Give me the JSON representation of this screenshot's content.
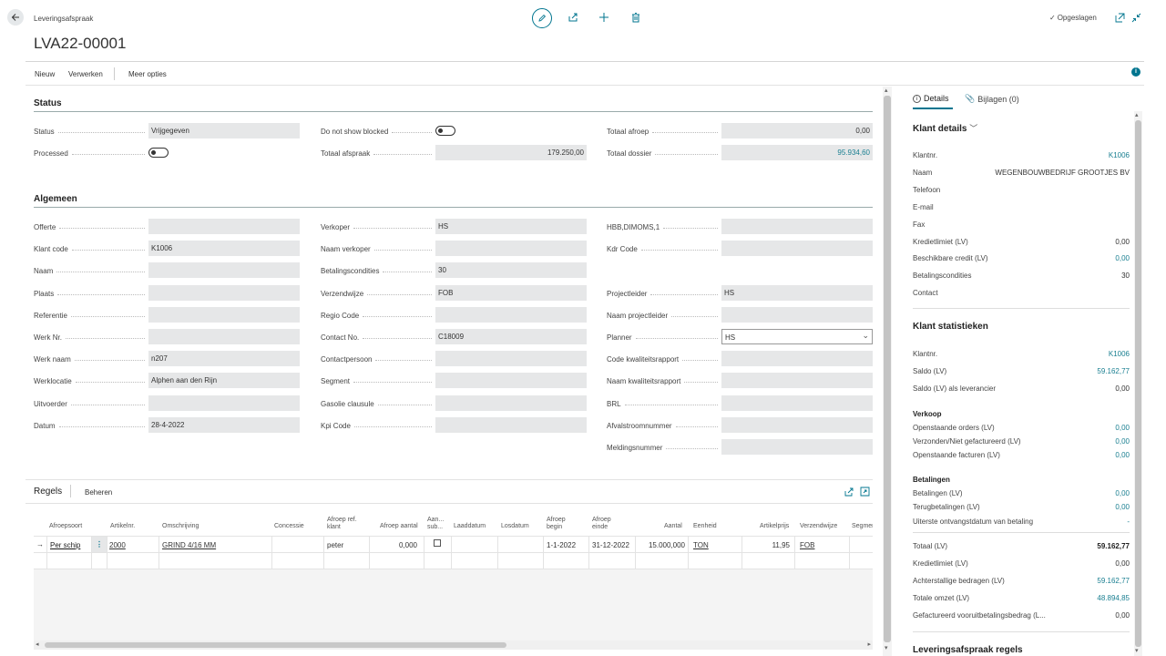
{
  "header": {
    "breadcrumb": "Leveringsafspraak",
    "title": "LVA22-00001",
    "saved_label": "Opgeslagen"
  },
  "actionbar": {
    "new_label": "Nieuw",
    "process_label": "Verwerken",
    "more_label": "Meer opties"
  },
  "status": {
    "heading": "Status",
    "status_label": "Status",
    "status_value": "Vrijgegeven",
    "processed_label": "Processed",
    "dnsb_label": "Do not show blocked",
    "totaal_afspraak_label": "Totaal afspraak",
    "totaal_afspraak_value": "179.250,00",
    "totaal_afroep_label": "Totaal afroep",
    "totaal_afroep_value": "0,00",
    "totaal_dossier_label": "Totaal dossier",
    "totaal_dossier_value": "95.934,60"
  },
  "algemeen": {
    "heading": "Algemeen",
    "col1": [
      {
        "label": "Offerte",
        "value": ""
      },
      {
        "label": "Klant code",
        "value": "K1006"
      },
      {
        "label": "Naam",
        "value": ""
      },
      {
        "label": "Plaats",
        "value": ""
      },
      {
        "label": "Referentie",
        "value": ""
      },
      {
        "label": "Werk Nr.",
        "value": ""
      },
      {
        "label": "Werk naam",
        "value": "n207"
      },
      {
        "label": "Werklocatie",
        "value": "Alphen aan den Rijn"
      },
      {
        "label": "Uitvoerder",
        "value": ""
      },
      {
        "label": "Datum",
        "value": "28-4-2022"
      }
    ],
    "col2": [
      {
        "label": "Verkoper",
        "value": "HS"
      },
      {
        "label": "Naam verkoper",
        "value": ""
      },
      {
        "label": "Betalingscondities",
        "value": "30"
      },
      {
        "label": "Verzendwijze",
        "value": "FOB"
      },
      {
        "label": "Regio Code",
        "value": ""
      },
      {
        "label": "Contact No.",
        "value": "C18009"
      },
      {
        "label": "Contactpersoon",
        "value": ""
      },
      {
        "label": "Segment",
        "value": ""
      },
      {
        "label": "Gasolie clausule",
        "value": ""
      },
      {
        "label": "Kpi Code",
        "value": ""
      }
    ],
    "col3": [
      {
        "label": "HBB,DIMOMS,1",
        "value": ""
      },
      {
        "label": "Kdr Code",
        "value": ""
      },
      {
        "label": "Projectleider",
        "value": "HS"
      },
      {
        "label": "Naam projectleider",
        "value": ""
      },
      {
        "label": "Planner",
        "value": "HS"
      },
      {
        "label": "Code kwaliteitsrapport",
        "value": ""
      },
      {
        "label": "Naam kwaliteitsrapport",
        "value": ""
      },
      {
        "label": "BRL",
        "value": ""
      },
      {
        "label": "Afvalstroomnummer",
        "value": ""
      },
      {
        "label": "Meldingsnummer",
        "value": ""
      }
    ]
  },
  "regels": {
    "heading": "Regels",
    "manage_label": "Beheren",
    "columns": {
      "afroepsoort": "Afroepsoort",
      "artikelnr": "Artikelnr.",
      "omschrijving": "Omschrijving",
      "concessie": "Concessie",
      "afroep_ref_klant_1": "Afroep ref.",
      "afroep_ref_klant_2": "klant",
      "afroep_aantal": "Afroep aantal",
      "aan_sub_1": "Aan...",
      "aan_sub_2": "sub...",
      "laaddatum": "Laaddatum",
      "losdatum": "Losdatum",
      "afroep_begin_1": "Afroep",
      "afroep_begin_2": "begin",
      "afroep_einde_1": "Afroep",
      "afroep_einde_2": "einde",
      "aantal": "Aantal",
      "eenheid": "Eenheid",
      "artikelprijs": "Artikelprijs",
      "verzendwijze": "Verzendwijze",
      "segment": "Segmer"
    },
    "row": {
      "afroepsoort": "Per schip",
      "artikelnr": "2000",
      "omschrijving": "GRIND 4/16 MM",
      "afroep_ref_klant": "peter",
      "afroep_aantal": "0,000",
      "afroep_begin": "1-1-2022",
      "afroep_einde": "31-12-2022",
      "aantal": "15.000,000",
      "eenheid": "TON",
      "artikelprijs": "11,95",
      "verzendwijze": "FOB"
    }
  },
  "factbox": {
    "tab_details": "Details",
    "tab_attachments": "Bijlagen (0)",
    "klant_details": {
      "heading": "Klant details",
      "rows": [
        {
          "label": "Klantnr.",
          "value": "K1006",
          "link": true
        },
        {
          "label": "Naam",
          "value": "WEGENBOUWBEDRIJF GROOTJES BV",
          "link": false
        },
        {
          "label": "Telefoon",
          "value": "",
          "link": false
        },
        {
          "label": "E-mail",
          "value": "",
          "link": false
        },
        {
          "label": "Fax",
          "value": "",
          "link": false
        },
        {
          "label": "Kredietlimiet (LV)",
          "value": "0,00",
          "link": false
        },
        {
          "label": "Beschikbare credit (LV)",
          "value": "0,00",
          "link": true
        },
        {
          "label": "Betalingscondities",
          "value": "30",
          "link": false
        },
        {
          "label": "Contact",
          "value": "",
          "link": false
        }
      ]
    },
    "klant_stats": {
      "heading": "Klant statistieken",
      "rows": [
        {
          "label": "Klantnr.",
          "value": "K1006",
          "link": true
        },
        {
          "label": "Saldo (LV)",
          "value": "59.162,77",
          "link": true
        },
        {
          "label": "Saldo (LV) als leverancier",
          "value": "0,00",
          "link": false
        }
      ],
      "verkoop_heading": "Verkoop",
      "verkoop": [
        {
          "label": "Openstaande orders (LV)",
          "value": "0,00",
          "link": true
        },
        {
          "label": "Verzonden/Niet gefactureerd (LV)",
          "value": "0,00",
          "link": true
        },
        {
          "label": "Openstaande facturen (LV)",
          "value": "0,00",
          "link": true
        }
      ],
      "betalingen_heading": "Betalingen",
      "betalingen": [
        {
          "label": "Betalingen (LV)",
          "value": "0,00",
          "link": true
        },
        {
          "label": "Terugbetalingen (LV)",
          "value": "0,00",
          "link": true
        },
        {
          "label": "Uiterste ontvangstdatum van betaling",
          "value": "-",
          "link": true
        }
      ],
      "totals": [
        {
          "label": "Totaal (LV)",
          "value": "59.162,77",
          "link": false,
          "bold": true
        },
        {
          "label": "Kredietlimiet (LV)",
          "value": "0,00",
          "link": false,
          "bold": false
        },
        {
          "label": "Achterstallige bedragen (LV)",
          "value": "59.162,77",
          "link": true,
          "bold": false
        },
        {
          "label": "Totale omzet (LV)",
          "value": "48.894,85",
          "link": true,
          "bold": false
        },
        {
          "label": "Gefactureerd vooruitbetalingsbedrag (L...",
          "value": "0,00",
          "link": false,
          "bold": false
        }
      ]
    },
    "leveringsafspraak_heading": "Leveringsafspraak regels"
  },
  "colors": {
    "accent": "#00758f",
    "link": "#1a7f91",
    "field_bg": "#e6e7e8"
  }
}
